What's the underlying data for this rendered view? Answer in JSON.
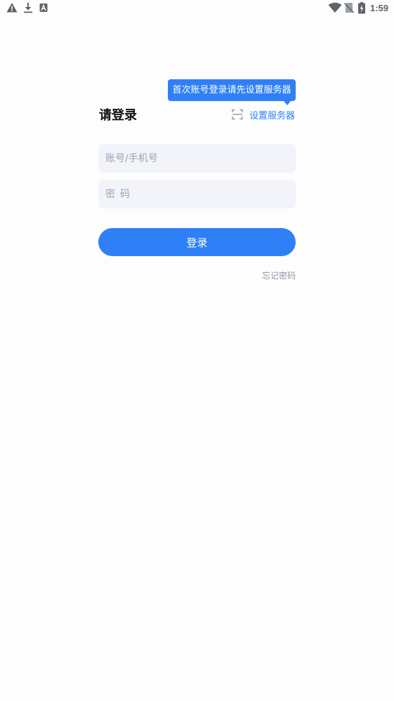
{
  "status_bar": {
    "time": "1:59",
    "left_icons": [
      "warning-icon",
      "download-icon",
      "text-a-icon"
    ],
    "right_icons": [
      "wifi-icon",
      "no-sim-icon",
      "battery-charging-icon"
    ]
  },
  "login": {
    "tooltip": "首次账号登录请先设置服务器",
    "title": "请登录",
    "server_link_label": "设置服务器",
    "account_placeholder": "账号/手机号",
    "password_placeholder": "密码",
    "login_button_label": "登录",
    "forgot_password_label": "忘记密码"
  },
  "colors": {
    "accent": "#2f80f7",
    "input_bg": "#f2f4f9",
    "placeholder": "#9aa4b4",
    "muted_link": "#8e97a6"
  }
}
